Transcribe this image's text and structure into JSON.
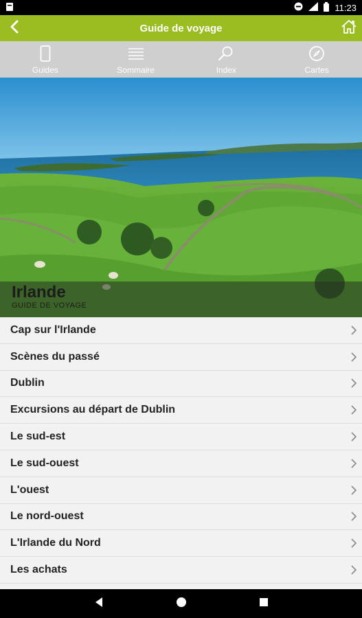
{
  "status_bar": {
    "time": "11:23",
    "icons": [
      "notification-icon",
      "do-not-disturb-icon",
      "signal-icon",
      "battery-icon"
    ]
  },
  "app_bar": {
    "title": "Guide de voyage",
    "back_icon": "back-arrow-icon",
    "home_icon": "home-icon",
    "color": "#9bbd22"
  },
  "tabs": [
    {
      "label": "Guides",
      "icon": "phone-icon"
    },
    {
      "label": "Sommaire",
      "icon": "list-icon"
    },
    {
      "label": "Index",
      "icon": "magnifier-icon"
    },
    {
      "label": "Cartes",
      "icon": "compass-icon"
    }
  ],
  "hero": {
    "title": "Irlande",
    "subtitle": "GUIDE DE VOYAGE"
  },
  "chapters": [
    {
      "label": "Cap sur l'Irlande"
    },
    {
      "label": "Scènes du passé"
    },
    {
      "label": "Dublin"
    },
    {
      "label": "Excursions au départ de Dublin"
    },
    {
      "label": "Le sud-est"
    },
    {
      "label": "Le sud-ouest"
    },
    {
      "label": "L'ouest"
    },
    {
      "label": "Le nord-ouest"
    },
    {
      "label": "L'Irlande du Nord"
    },
    {
      "label": "Les achats"
    }
  ],
  "nav_bar": {
    "icons": [
      "back-triangle-icon",
      "home-circle-icon",
      "recents-square-icon"
    ]
  }
}
